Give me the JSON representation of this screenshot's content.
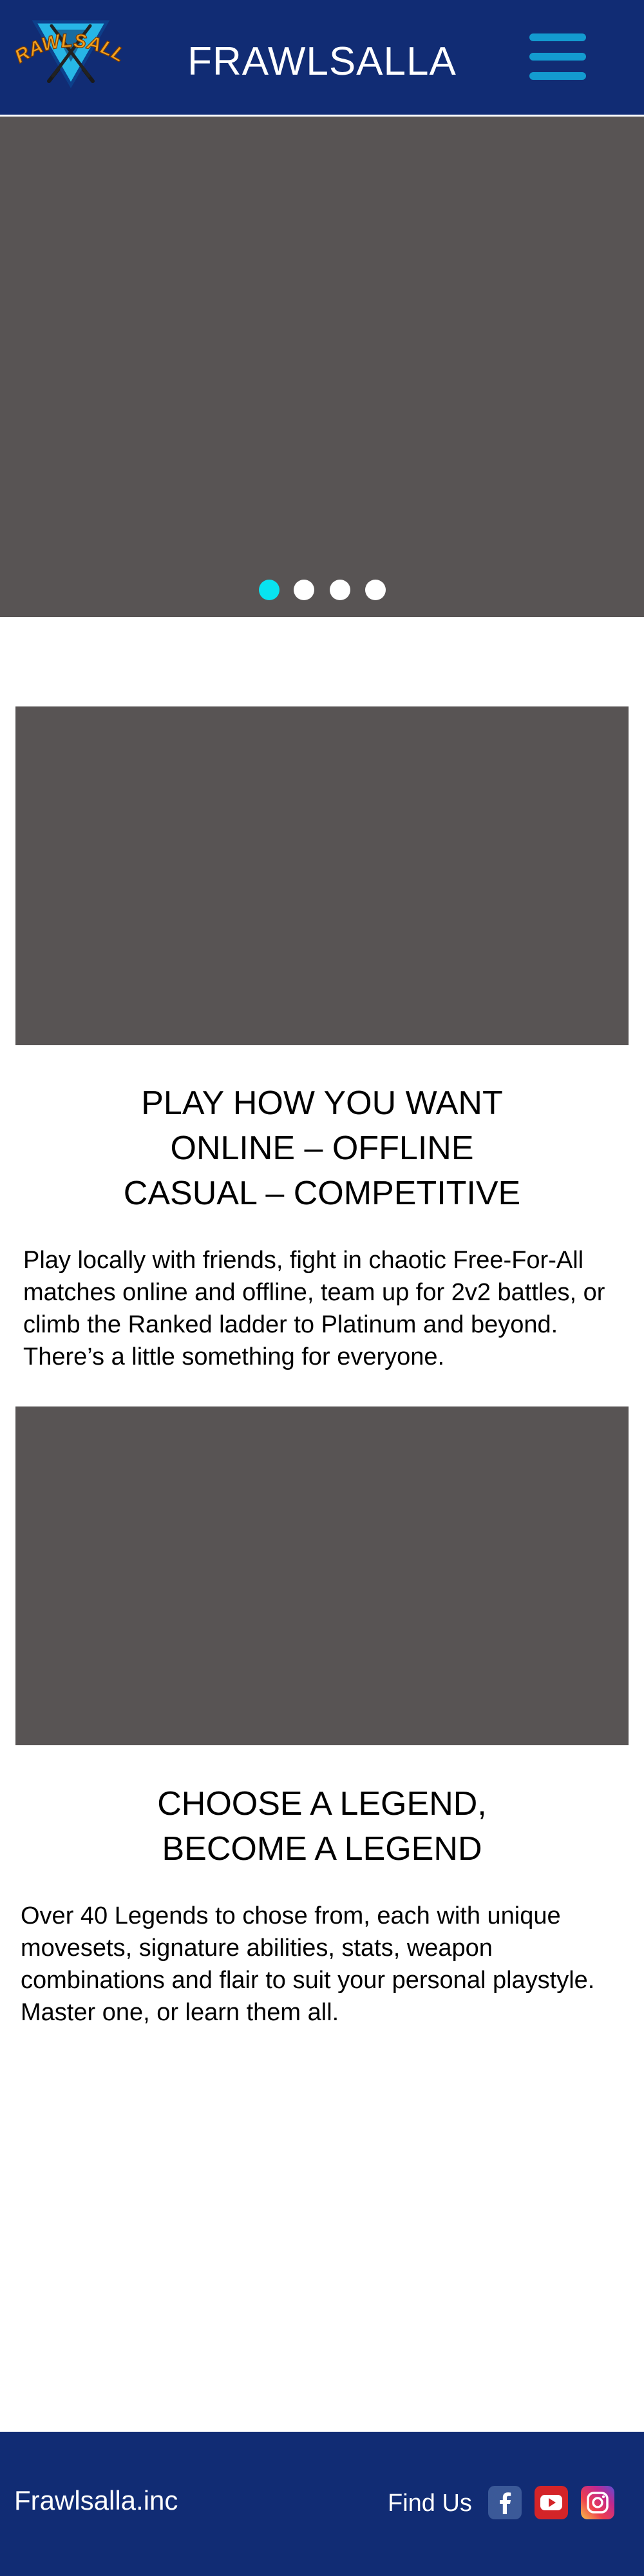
{
  "header": {
    "logo_text": "FRAWLSALLA",
    "site_title": "FRAWLSALLA",
    "menu_icon": "hamburger-menu-icon",
    "background_color": "#112c74",
    "menu_color": "#139bd0"
  },
  "carousel": {
    "slide_count": 4,
    "active_index": 0,
    "active_dot_color": "#08e3f0",
    "dot_color": "#ffffff",
    "placeholder_color": "#585454"
  },
  "sections": [
    {
      "headline_lines": [
        "PLAY HOW YOU WANT",
        "ONLINE – OFFLINE",
        "CASUAL – COMPETITIVE"
      ],
      "body": "Play locally with friends, fight in chaotic Free-For-All matches online and offline, team up for 2v2 battles, or climb the Ranked ladder to Platinum and beyond. There’s a little something for everyone."
    },
    {
      "headline_lines": [
        "CHOOSE A LEGEND,",
        "BECOME A LEGEND"
      ],
      "body": "Over 40 Legends to chose from, each with unique movesets, signature abilities, stats, weapon combinations and flair to suit your personal playstyle. Master one, or learn them all."
    }
  ],
  "footer": {
    "brand": "Frawlsalla.inc",
    "find_us_label": "Find Us",
    "social_icons": [
      "facebook-icon",
      "youtube-icon",
      "instagram-icon"
    ],
    "facebook_color": "#3b5998",
    "youtube_color": "#d42428",
    "background_color": "#112c74"
  }
}
